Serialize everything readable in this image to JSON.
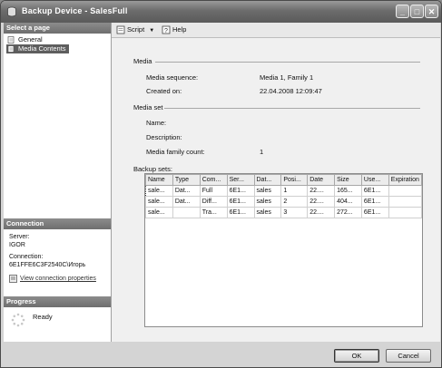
{
  "window": {
    "title": "Backup Device - SalesFull"
  },
  "sidebar": {
    "select_page_header": "Select a page",
    "pages": [
      {
        "label": "General",
        "icon": "page-icon"
      },
      {
        "label": "Media Contents",
        "icon": "page-icon"
      }
    ],
    "connection_header": "Connection",
    "server_label": "Server:",
    "server_value": "IGOR",
    "connection_label": "Connection:",
    "connection_value": "6E1FFE6C3F2540C\\Игорь",
    "view_connection_link": "View connection properties",
    "progress_header": "Progress",
    "progress_status": "Ready"
  },
  "toolbar": {
    "script_label": "Script",
    "help_label": "Help"
  },
  "media": {
    "group_label": "Media",
    "sequence_label": "Media sequence:",
    "sequence_value": "Media 1, Family 1",
    "created_label": "Created on:",
    "created_value": "22.04.2008 12:09:47"
  },
  "media_set": {
    "group_label": "Media set",
    "name_label": "Name:",
    "description_label": "Description:",
    "family_count_label": "Media family count:",
    "family_count_value": "1"
  },
  "backup_sets": {
    "label": "Backup sets:",
    "columns": [
      "Name",
      "Type",
      "Com...",
      "Ser...",
      "Dat...",
      "Posi...",
      "Date",
      "Size",
      "Use...",
      "Expiration"
    ],
    "rows": [
      [
        "sale...",
        "Dat...",
        "Full",
        "6E1...",
        "sales",
        "1",
        "22....",
        "165...",
        "6E1...",
        ""
      ],
      [
        "sale...",
        "Dat...",
        "Diff...",
        "6E1...",
        "sales",
        "2",
        "22....",
        "404...",
        "6E1...",
        ""
      ],
      [
        "sale...",
        "",
        "Tra...",
        "6E1...",
        "sales",
        "3",
        "22....",
        "272...",
        "6E1...",
        ""
      ]
    ]
  },
  "buttons": {
    "ok": "OK",
    "cancel": "Cancel"
  },
  "colors": {
    "titlebar": "#6c6c6c",
    "section_header": "#7a7a7a",
    "selection": "#5e5e5e"
  }
}
